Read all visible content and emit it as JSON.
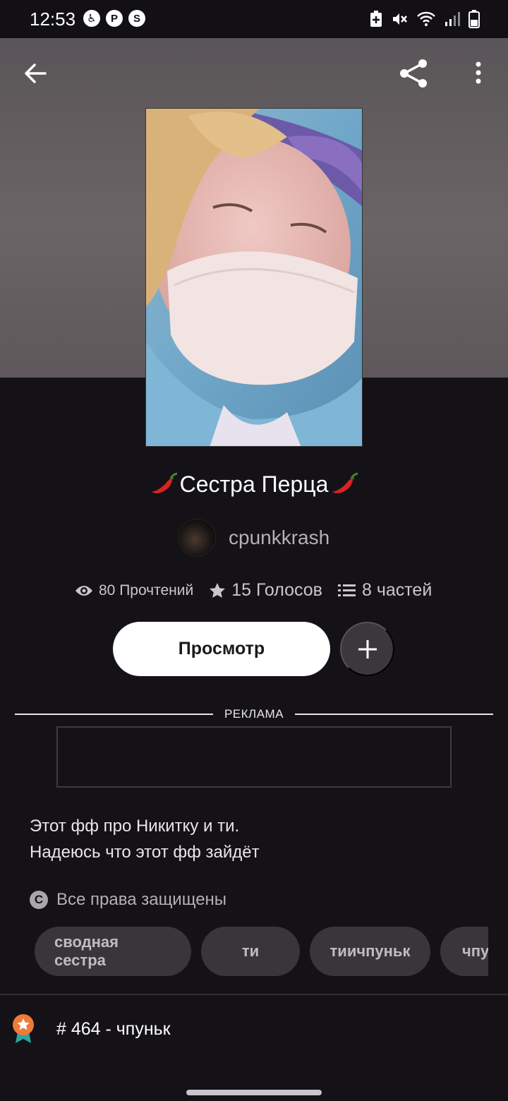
{
  "status_bar": {
    "time": "12:53",
    "left_icons": [
      "accessibility-icon",
      "pinterest-icon",
      "shazam-icon"
    ],
    "right_icons": [
      "battery-saver-icon",
      "mute-icon",
      "wifi-icon",
      "signal-icon",
      "battery-icon"
    ]
  },
  "header": {
    "background_color": "#5e585b",
    "actions": [
      "back-arrow-icon",
      "share-icon",
      "more-vert-icon"
    ]
  },
  "story": {
    "title": "Сестра Перца",
    "title_emoji": "pepper-icon",
    "author": "cpunkkrash",
    "stats": {
      "reads": "80 Прочтений",
      "votes": "15 Голосов",
      "parts": "8 частей"
    },
    "view_button_label": "Просмотр"
  },
  "ad": {
    "label": "РЕКЛАМА"
  },
  "description": {
    "line1": "Этот фф про Никитку и ти.",
    "line2": "Надеюсь что этот фф зайдёт"
  },
  "copyright": {
    "text": "Все права защищены"
  },
  "tags": [
    "сводная сестра",
    "ти",
    "тиичпуньк",
    "чпу"
  ],
  "rank": {
    "text": "# 464 - чпуньк",
    "badge_color": "#f07a3a"
  },
  "colors": {
    "page_bg": "#141216",
    "tag_bg": "#38363a",
    "primary_button_bg": "#ffffff"
  }
}
